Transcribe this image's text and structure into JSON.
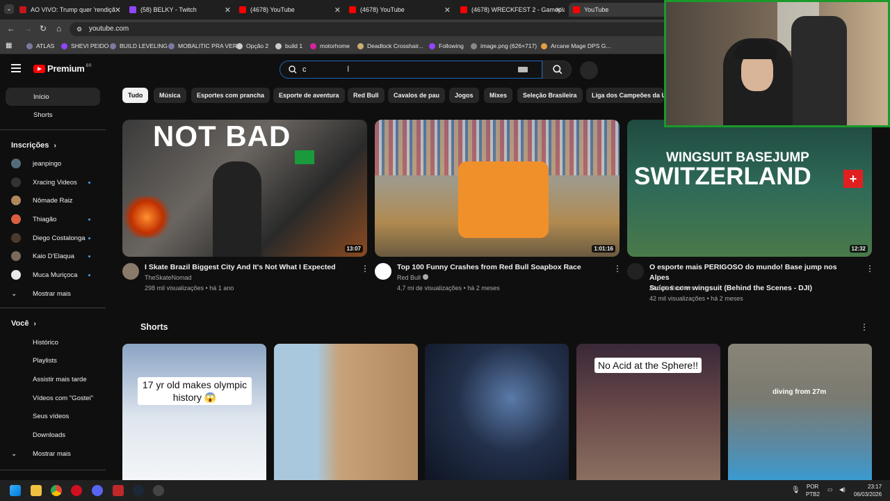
{
  "browser": {
    "tabs": [
      {
        "label": "AO VIVO: Trump quer 'rendiçã",
        "color": "#c4161c"
      },
      {
        "label": "(58) BELKY - Twitch",
        "color": "#9146ff"
      },
      {
        "label": "(4678) YouTube",
        "color": "#ff0000"
      },
      {
        "label": "(4678) YouTube",
        "color": "#ff0000"
      },
      {
        "label": "(4678) WRECKFEST 2 - Gamepla",
        "color": "#ff0000"
      },
      {
        "label": "YouTube",
        "color": "#ff0000"
      }
    ],
    "url": "youtube.com",
    "bookmarks": [
      "ATLAS",
      "SHEVI PEIDO",
      "BUILD LEVELING",
      "MOBALITIC PRA VER",
      "Opção 2",
      "build 1",
      "motorhome",
      "Deadlock Crosshair...",
      "Following",
      "image.png (626×717)",
      "Arcane Mage DPS G..."
    ]
  },
  "header": {
    "logo_text": "Premium",
    "country": "BR",
    "search_value": "c"
  },
  "sidebar": {
    "main": [
      "Início",
      "Shorts"
    ],
    "subs_title": "Inscrições",
    "subscriptions": [
      {
        "name": "jeanpingo",
        "color": "#556b7a",
        "dot": false
      },
      {
        "name": "Xracing Videos",
        "color": "#333333",
        "dot": true
      },
      {
        "name": "Nômade Raiz",
        "color": "#b0885a",
        "dot": false
      },
      {
        "name": "Thiagão",
        "color": "#d86040",
        "dot": true
      },
      {
        "name": "Diego Costalonga",
        "color": "#4a3a30",
        "dot": true
      },
      {
        "name": "Kaio D'Elaqua",
        "color": "#7a6a5a",
        "dot": true
      },
      {
        "name": "Muca Muriçoca",
        "color": "#e8e8e8",
        "dot": true
      }
    ],
    "subs_more": "Mostrar mais",
    "you_title": "Você",
    "you_items": [
      "Histórico",
      "Playlists",
      "Assistir mais tarde",
      "Vídeos com \"Gostei\"",
      "Seus vídeos",
      "Downloads"
    ],
    "you_more": "Mostrar mais"
  },
  "chips": [
    "Tudo",
    "Música",
    "Esportes com prancha",
    "Esporte de aventura",
    "Red Bull",
    "Cavalos de pau",
    "Jogos",
    "Mixes",
    "Seleção Brasileira",
    "Liga dos Campeões da U"
  ],
  "videos": [
    {
      "title": "I Skate Brazil Biggest City And It's Not What I Expected",
      "title2": "",
      "channel": "TheSkateNomad",
      "meta": "298 mil visualizações • há 1 ano",
      "duration": "13:07",
      "thumb_text": "NOT BAD",
      "avatar_color": "#8a7a6a"
    },
    {
      "title": "Top 100 Funny Crashes from Red Bull Soapbox Race",
      "title2": "",
      "channel": "Red Bull",
      "meta": "4,7 mi de visualizações • há 2 meses",
      "duration": "1:01:16",
      "thumb_text": "",
      "avatar_color": "#ffffff"
    },
    {
      "title": "O esporte mais PERIGOSO do mundo! Base jump nos Alpes",
      "title2": "Suíços com wingsuit (Behind the Scenes - DJI)",
      "channel": "Abdala Brothers",
      "meta": "42 mil visualizações • há 2 meses",
      "duration": "12:32",
      "thumb_text": "WINGSUIT BASEJUMP",
      "thumb_text2": "SWITZERLAND",
      "avatar_color": "#222222"
    }
  ],
  "shorts": {
    "title": "Shorts",
    "items": [
      {
        "caption": "17 yr old makes olympic history 😱"
      },
      {
        "caption": ""
      },
      {
        "caption": ""
      },
      {
        "caption": "No Acid at the Sphere!!"
      },
      {
        "caption": "diving from 27m"
      }
    ]
  },
  "taskbar": {
    "lang": "POR",
    "layout": "PTB2",
    "time": "23:17",
    "date": "06/03/2026"
  }
}
